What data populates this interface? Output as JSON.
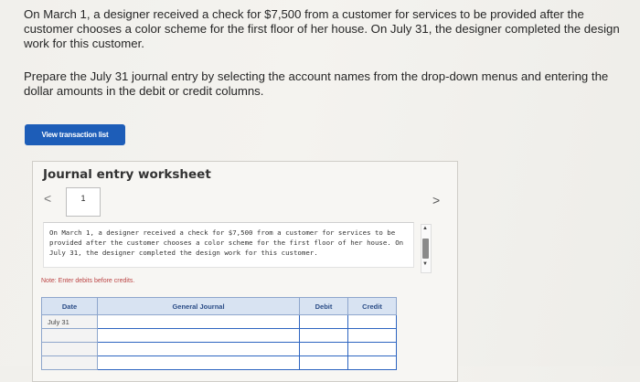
{
  "question": {
    "paragraph1": "On March 1, a designer received a check for $7,500 from a customer for services to be provided after the customer chooses a color scheme for the first floor of her house. On July 31, the designer completed the design work for this customer.",
    "paragraph2": "Prepare the July 31 journal entry by selecting the account names from the drop-down menus and entering the dollar amounts in the debit or credit columns."
  },
  "view_transaction_button": "View transaction list",
  "worksheet": {
    "title": "Journal entry worksheet",
    "prev_icon": "<",
    "next_icon": ">",
    "tab_number": "1",
    "description": "On March 1, a designer received a check for $7,500 from a customer for services to be provided after the customer chooses a color scheme for the first floor of her house. On July 31, the designer completed the design work for this customer.",
    "note": "Note: Enter debits before credits.",
    "table": {
      "headers": [
        "Date",
        "General Journal",
        "Debit",
        "Credit"
      ],
      "rows": [
        {
          "date": "July 31",
          "account": "",
          "debit": "",
          "credit": ""
        },
        {
          "date": "",
          "account": "",
          "debit": "",
          "credit": ""
        },
        {
          "date": "",
          "account": "",
          "debit": "",
          "credit": ""
        },
        {
          "date": "",
          "account": "",
          "debit": "",
          "credit": ""
        }
      ]
    }
  }
}
